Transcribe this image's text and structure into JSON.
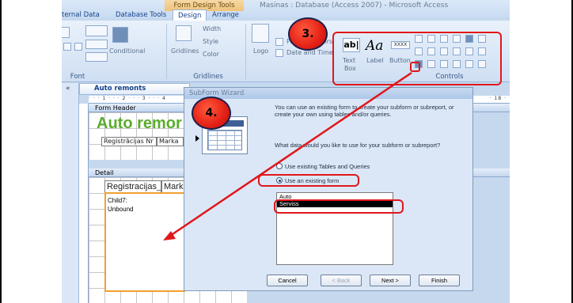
{
  "app": {
    "title": "Masinas : Database (Access 2007) - Microsoft Access",
    "context_tools": "Form Design Tools"
  },
  "tabs": [
    {
      "label": "ternal Data"
    },
    {
      "label": "Database Tools"
    },
    {
      "label": "Design"
    },
    {
      "label": "Arrange"
    }
  ],
  "ribbon": {
    "font_group": "Font",
    "gridlines_group": "Gridlines",
    "controls_group": "Controls",
    "conditional": "Conditional",
    "gridlines": "Gridlines",
    "width": "Width",
    "style": "Style",
    "color": "Color",
    "logo": "Logo",
    "page_numbers": "Page Numbers",
    "date_and_time": "Date and Time",
    "text_box_line1": "Text",
    "text_box_line2": "Box",
    "label": "Label",
    "button": "Button",
    "xxxx": "XXXX"
  },
  "document": {
    "tab": "Auto remonts",
    "ruler": "· · · 1 · · · 2 · · · 3 · · · 4",
    "ruler_right": "· 18 ·",
    "form_header": "Form Header",
    "detail": "Detail",
    "title": "Auto remor",
    "header_fields": [
      "Registrācijas Nr",
      "Marka"
    ],
    "detail_fields": [
      "Registracijas_",
      "Marka"
    ],
    "child_label": "Child7:",
    "child_value": "Unbound"
  },
  "wizard": {
    "title": "SubForm Wizard",
    "intro": "You can use an existing form to create your subform or subreport, or create your own using tables and/or queries.",
    "question": "What data would you like to use for your subform or subreport?",
    "option_tables": "Use existing Tables and Queries",
    "option_form": "Use an existing form",
    "forms": [
      "Auto",
      "Serviss"
    ],
    "buttons": {
      "cancel": "Cancel",
      "back": "< Back",
      "next": "Next >",
      "finish": "Finish"
    }
  },
  "annotations": {
    "step3": "3.",
    "step4": "4."
  }
}
